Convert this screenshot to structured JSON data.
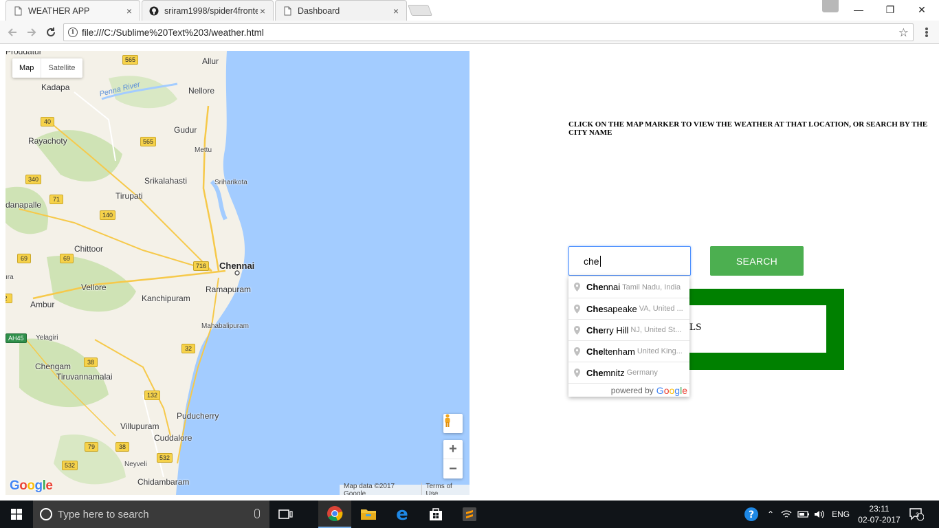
{
  "browser": {
    "tabs": [
      {
        "title": "WEATHER APP",
        "icon": "page-icon",
        "active": true
      },
      {
        "title": "sriram1998/spider4fronte",
        "icon": "github-icon",
        "active": false
      },
      {
        "title": "Dashboard",
        "icon": "page-icon",
        "active": false
      }
    ],
    "close_glyph": "×",
    "url": "file:///C:/Sublime%20Text%203/weather.html",
    "window_controls": {
      "minimize": "—",
      "maximize": "❐",
      "close": "✕"
    }
  },
  "map": {
    "type_options": [
      "Map",
      "Satellite"
    ],
    "selected_type": "Map",
    "labels": {
      "proddatur": "Proddatur",
      "allur": "Allur",
      "kadapa": "Kadapa",
      "penna_river": "Penna River",
      "nellore": "Nellore",
      "gudur": "Gudur",
      "rayachoty": "Rayachoty",
      "mettu": "Mettu",
      "srikalahasti": "Srikalahasti",
      "sriharikota": "Sriharikota",
      "tirupati": "Tirupati",
      "danapalle": "danapalle",
      "chittoor": "Chittoor",
      "chennai": "Chennai",
      "ira": "ıra",
      "vellore": "Vellore",
      "ramapuram": "Ramapuram",
      "ambur": "Ambur",
      "kanchipuram": "Kanchipuram",
      "mahabalipuram": "Mahabalipuram",
      "yelagiri": "Yelagiri",
      "chengam": "Chengam",
      "tiruvannamalai": "Tiruvannamalai",
      "puducherry": "Puducherry",
      "villupuram": "Villupuram",
      "cuddalore": "Cuddalore",
      "neyveli": "Neyveli",
      "chidambaram": "Chidambaram"
    },
    "shields": {
      "r565a": "565",
      "r40": "40",
      "r565b": "565",
      "r340": "340",
      "r71": "71",
      "r140": "140",
      "r69a": "69",
      "r69b": "69",
      "r716": "716",
      "r2": "2",
      "ah45": "AH45",
      "r32": "32",
      "r38a": "38",
      "r132": "132",
      "r79": "79",
      "r38b": "38",
      "r532a": "532",
      "r532b": "532"
    },
    "zoom_in": "+",
    "zoom_out": "−",
    "attribution": "Map data ©2017 Google",
    "terms": "Terms of Use",
    "logo": "Google",
    "colors": {
      "water": "#a3ccff",
      "land": "#f4f1e8",
      "green": "#cfe3b5"
    }
  },
  "app": {
    "instructions": "CLICK ON THE MAP MARKER TO VIEW THE WEATHER AT THAT LOCATION, OR SEARCH BY THE CITY NAME",
    "search_value": "che",
    "search_button": "SEARCH",
    "details_text": "LS",
    "colors": {
      "button": "#4caf50",
      "details_border": "#008000"
    }
  },
  "autocomplete": {
    "items": [
      {
        "match": "Che",
        "rest": "nnai",
        "secondary": "Tamil Nadu, India"
      },
      {
        "match": "Che",
        "rest": "sapeake",
        "secondary": "VA, United ..."
      },
      {
        "match": "Che",
        "rest": "rry Hill",
        "secondary": "NJ, United St..."
      },
      {
        "match": "Che",
        "rest": "ltenham",
        "secondary": "United King..."
      },
      {
        "match": "Che",
        "rest": "mnitz",
        "secondary": "Germany"
      }
    ],
    "powered_by": "powered by",
    "powered_brand": "Google"
  },
  "taskbar": {
    "search_placeholder": "Type here to search",
    "language": "ENG",
    "time": "23:11",
    "date": "02-07-2017",
    "notification_count": "3"
  }
}
